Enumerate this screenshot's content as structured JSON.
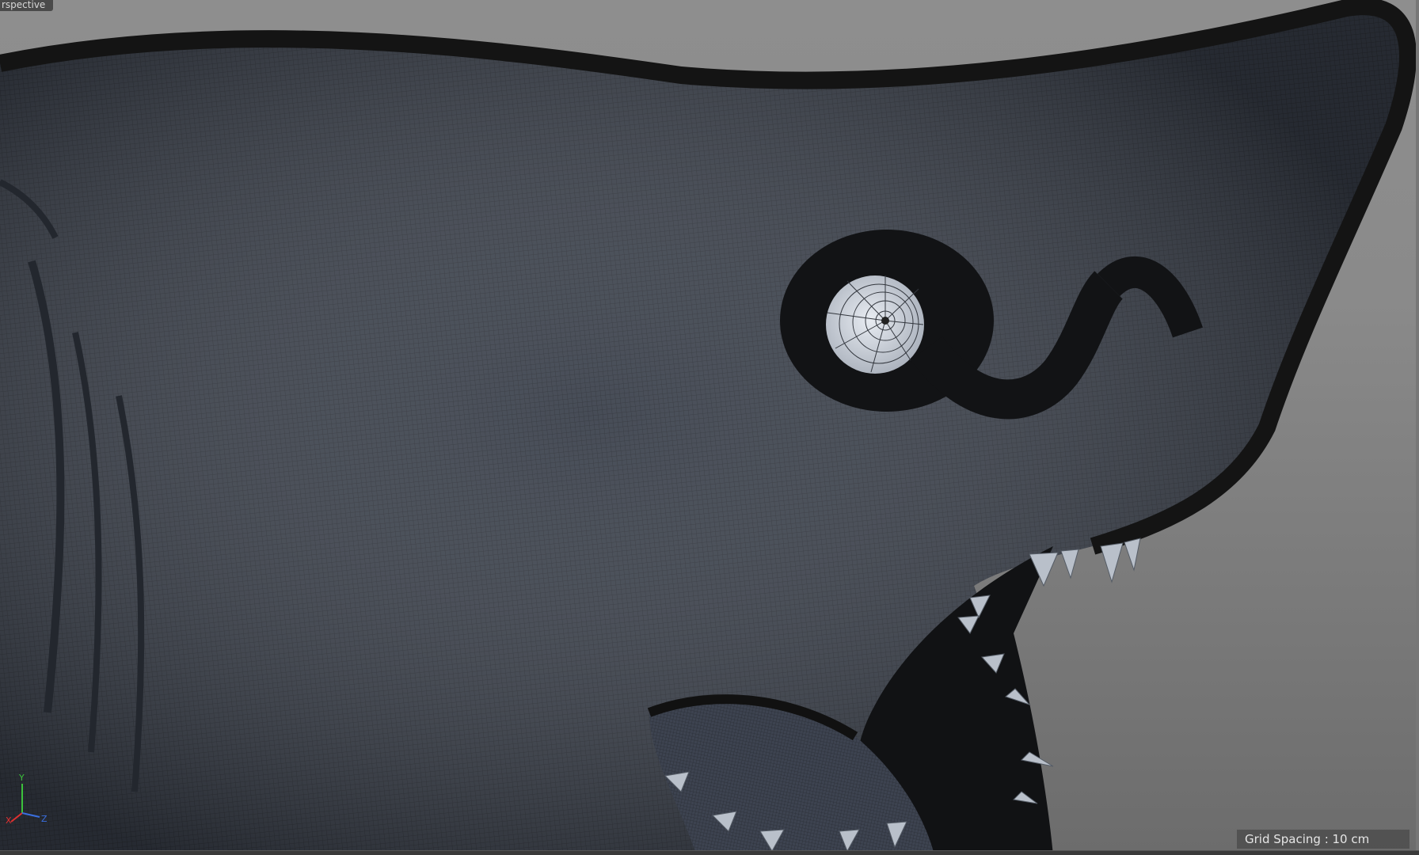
{
  "viewport": {
    "view_name": "rspective",
    "grid_spacing": "Grid Spacing : 10 cm",
    "background_color": "#8a8a8a"
  },
  "axis_gizmo": {
    "x_label": "X",
    "y_label": "Y",
    "z_label": "Z",
    "colors": {
      "x": "#e03030",
      "y": "#3cc23c",
      "z": "#3a6fe0"
    }
  },
  "model": {
    "description_icon": "shark-head-wireframe",
    "mesh_color": "#3a3f48",
    "wire_color": "#2a2e35",
    "eye_color": "#d9dde3"
  }
}
